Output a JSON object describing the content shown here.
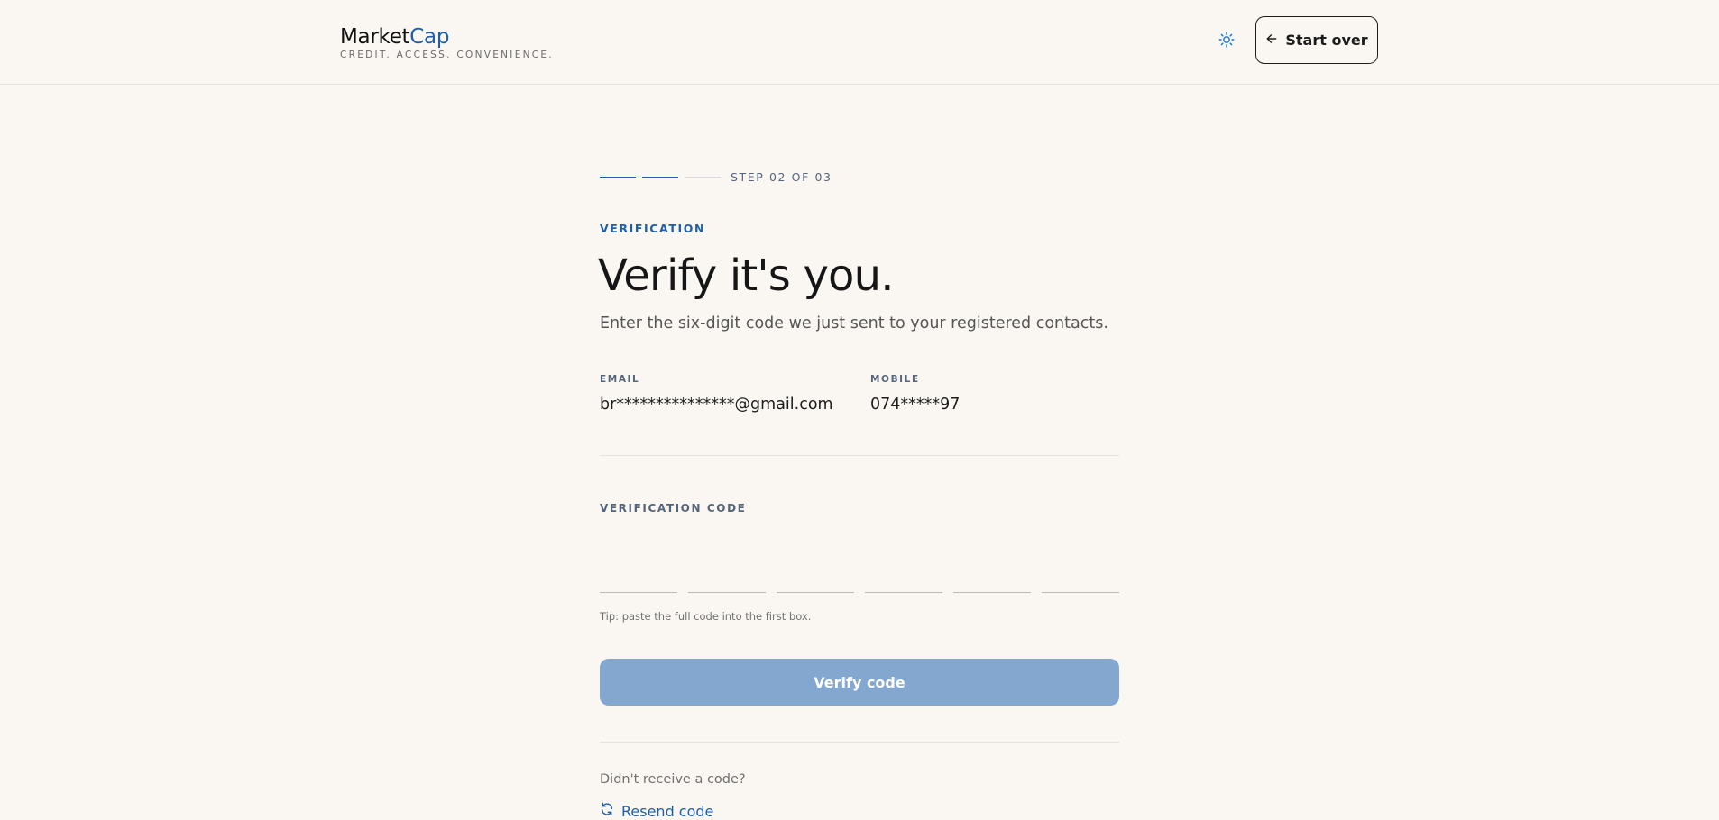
{
  "header": {
    "brand": {
      "name_main": "Market",
      "name_accent": "Cap",
      "tagline": "CREDIT. ACCESS. CONVENIENCE."
    },
    "theme_toggle_icon": "sun-icon",
    "start_over": {
      "icon": "arrow-left-icon",
      "label": "Start over"
    }
  },
  "progress": {
    "current_step": 2,
    "total_steps": 3,
    "label": "STEP 02 OF 03"
  },
  "main": {
    "eyebrow": "VERIFICATION",
    "title": "Verify it's you.",
    "subtitle": "Enter the six-digit code we just sent to your registered contacts.",
    "contacts": {
      "email": {
        "label": "EMAIL",
        "value": "br***************@gmail.com"
      },
      "mobile": {
        "label": "MOBILE",
        "value": "074*****97"
      }
    },
    "code": {
      "label": "VERIFICATION CODE",
      "digits": [
        "",
        "",
        "",
        "",
        "",
        ""
      ],
      "tip": "Tip: paste the full code into the first box."
    },
    "verify_button": {
      "label": "Verify code",
      "disabled": true
    },
    "resend": {
      "prompt": "Didn't receive a code?",
      "icon": "refresh-icon",
      "label": "Resend code"
    }
  },
  "colors": {
    "background": "#faf7f3",
    "accent": "#1f5fa8",
    "button_disabled": "#84a7d0",
    "divider": "#e4e0da"
  }
}
